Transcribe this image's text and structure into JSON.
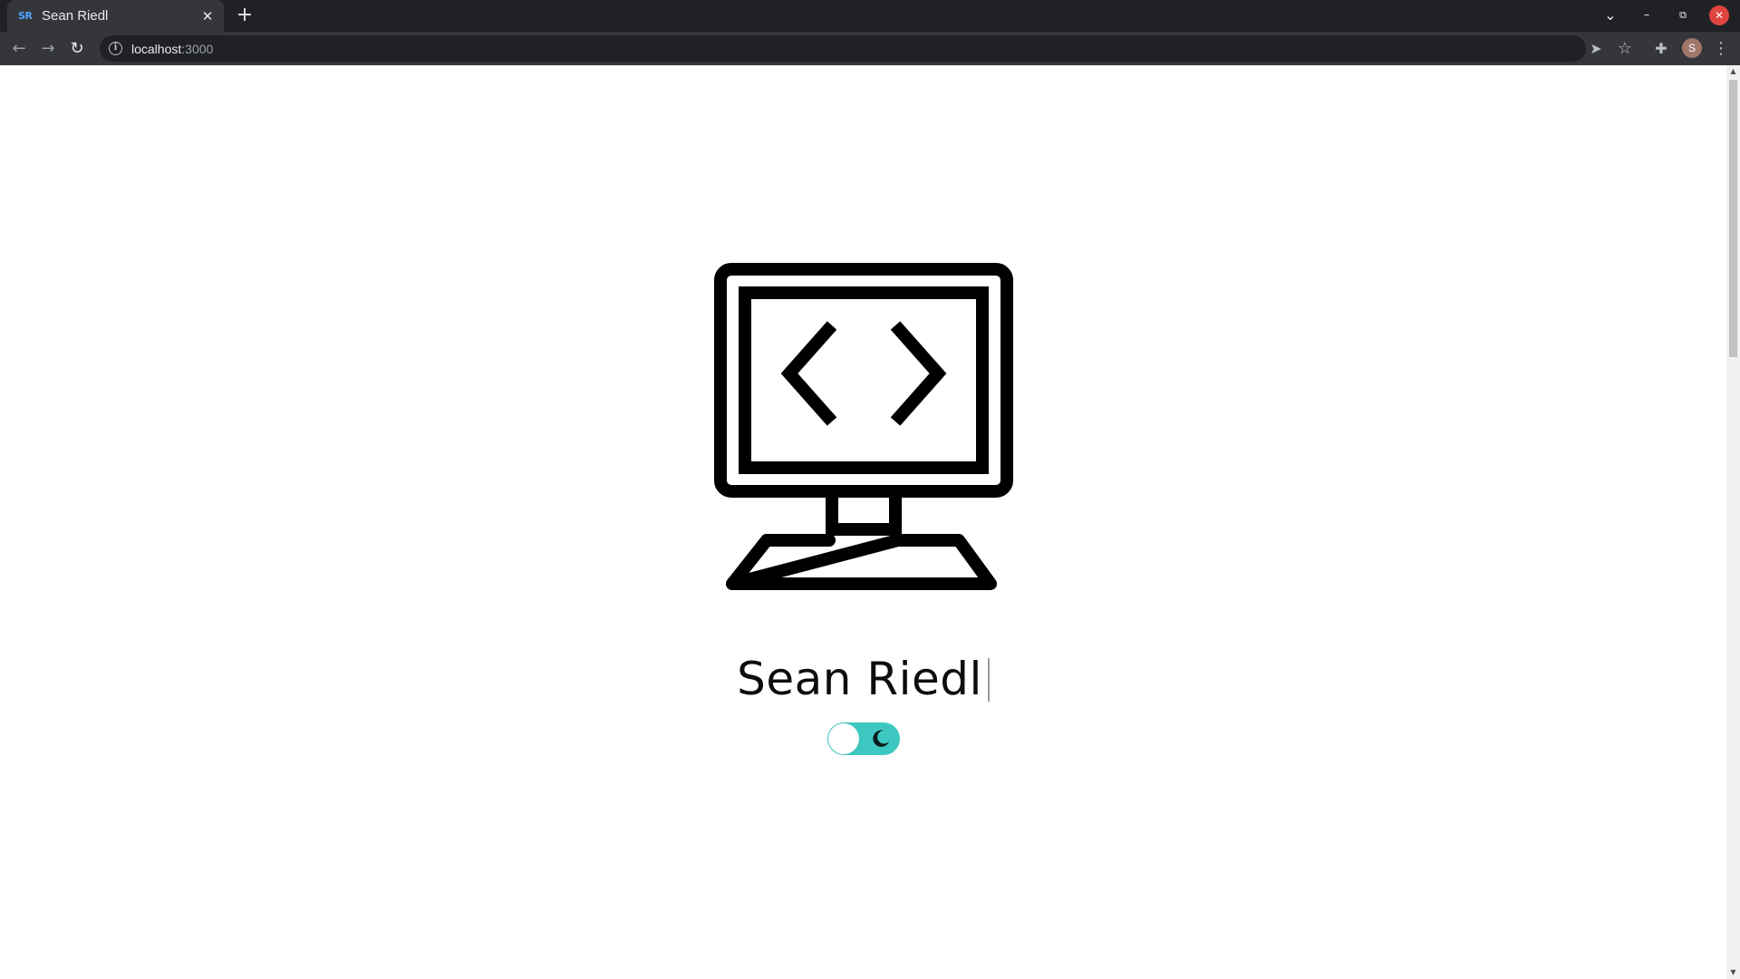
{
  "browser": {
    "tab": {
      "favicon_text": "SR",
      "title": "Sean Riedl",
      "close_glyph": "✕"
    },
    "new_tab_glyph": "+",
    "window_controls": {
      "dropdown": "⌄",
      "minimize": "–",
      "restore": "⧉",
      "close": "✕"
    },
    "nav": {
      "back": "←",
      "forward": "→",
      "reload": "↻"
    },
    "address": {
      "host": "localhost",
      "port": ":3000",
      "info_glyph": "i"
    },
    "toolbar_icons": {
      "send": "➤",
      "bookmark": "☆",
      "extensions": "✚",
      "menu": "⋮"
    },
    "profile_initial": "S"
  },
  "page": {
    "hero_icon": "monitor-code-icon",
    "name": "Sean Riedl",
    "theme_toggle": {
      "state": "on",
      "icon": "moon-icon",
      "accent": "#3cc8c0"
    }
  },
  "colors": {
    "chrome_dark": "#202124",
    "chrome_bar": "#35363a",
    "accent": "#3cc8c0",
    "text": "#0d0d0d"
  }
}
